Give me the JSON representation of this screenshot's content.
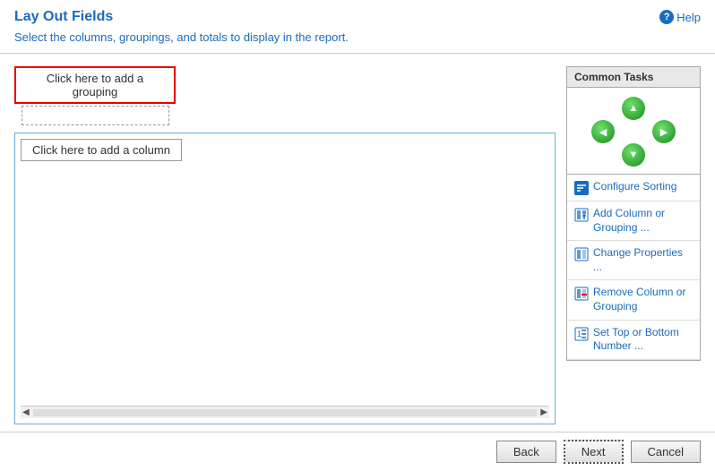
{
  "header": {
    "title": "Lay Out Fields",
    "help_label": "Help"
  },
  "subtitle": {
    "text_before": "Select the columns, groupings, and totals to ",
    "highlight": "display",
    "text_after": " in the report."
  },
  "grouping": {
    "add_grouping_label": "Click here to add a grouping"
  },
  "column": {
    "add_column_label": "Click here to add a column"
  },
  "common_tasks": {
    "header": "Common Tasks",
    "items": [
      {
        "id": "configure-sorting",
        "label": "Configure Sorting",
        "icon": "sort-icon"
      },
      {
        "id": "add-column-grouping",
        "label": "Add Column or Grouping ...",
        "icon": "add-icon"
      },
      {
        "id": "change-properties",
        "label": "Change Properties ...",
        "icon": "change-icon"
      },
      {
        "id": "remove-column-grouping",
        "label": "Remove Column or Grouping",
        "icon": "remove-icon"
      },
      {
        "id": "set-top-bottom",
        "label": "Set Top or Bottom Number ...",
        "icon": "topbottom-icon"
      }
    ]
  },
  "footer": {
    "back_label": "Back",
    "next_label": "Next",
    "cancel_label": "Cancel"
  }
}
